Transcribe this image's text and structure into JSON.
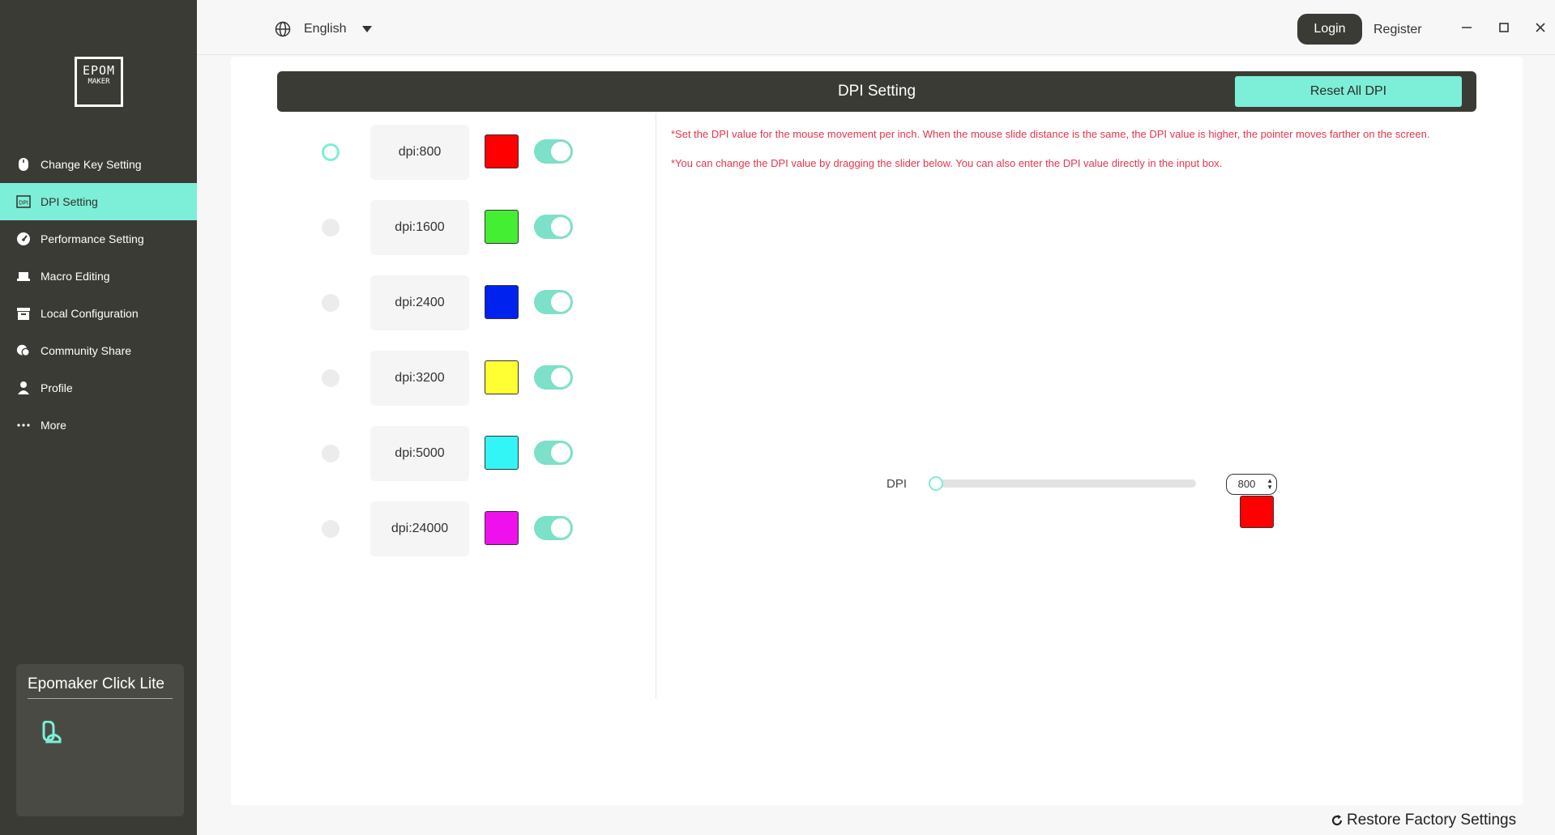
{
  "sidebar": {
    "logo_line1": "EPOM",
    "logo_line2": "MAKER",
    "items": [
      {
        "label": "Change Key Setting",
        "icon": "mouse-icon"
      },
      {
        "label": "DPI Setting",
        "icon": "dpi-icon",
        "active": true
      },
      {
        "label": "Performance Setting",
        "icon": "gauge-icon"
      },
      {
        "label": "Macro Editing",
        "icon": "keyboard-icon"
      },
      {
        "label": "Local Configuration",
        "icon": "archive-icon"
      },
      {
        "label": "Community Share",
        "icon": "chat-icon"
      },
      {
        "label": "Profile",
        "icon": "user-icon"
      },
      {
        "label": "More",
        "icon": "more-icon"
      }
    ],
    "device": {
      "name": "Epomaker Click Lite",
      "icon": "mouse-device-icon"
    }
  },
  "topbar": {
    "language": "English",
    "login_label": "Login",
    "register_label": "Register"
  },
  "header": {
    "title": "DPI Setting",
    "reset_label": "Reset All DPI"
  },
  "dpi_levels": [
    {
      "label": "dpi:800",
      "color": "#ff0000",
      "selected": true,
      "enabled": true
    },
    {
      "label": "dpi:1600",
      "color": "#44ee33",
      "selected": false,
      "enabled": true
    },
    {
      "label": "dpi:2400",
      "color": "#0022ee",
      "selected": false,
      "enabled": true
    },
    {
      "label": "dpi:3200",
      "color": "#ffff33",
      "selected": false,
      "enabled": true
    },
    {
      "label": "dpi:5000",
      "color": "#33f5f5",
      "selected": false,
      "enabled": true
    },
    {
      "label": "dpi:24000",
      "color": "#ee11ee",
      "selected": false,
      "enabled": true
    }
  ],
  "notes": [
    "*Set the DPI value for the mouse movement per inch. When the mouse slide distance is the same, the DPI value is higher, the pointer moves farther on the screen.",
    "*You can change the DPI value by dragging the slider below. You can also enter the DPI value directly in the input box."
  ],
  "slider": {
    "label": "DPI",
    "value": "800",
    "fraction": 0.0,
    "preview_color": "#ff0000"
  },
  "footer": {
    "restore_label": "Restore Factory Settings"
  }
}
